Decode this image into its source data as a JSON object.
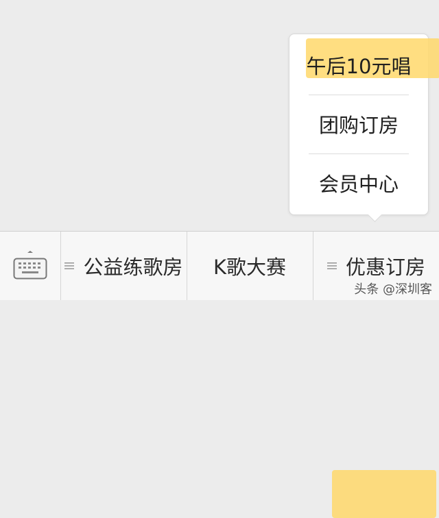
{
  "popup": {
    "items": [
      {
        "label": "午后10元唱"
      },
      {
        "label": "团购订房"
      },
      {
        "label": "会员中心"
      }
    ]
  },
  "menubar": {
    "keyboard_icon": "keyboard-icon",
    "tabs": [
      {
        "label": "公益练歌房",
        "icon": "menu-lines-icon"
      },
      {
        "label": "K歌大赛"
      },
      {
        "label": "优惠订房",
        "icon": "menu-lines-icon"
      }
    ]
  },
  "watermark": {
    "text": "头条 @深圳客"
  },
  "colors": {
    "highlight": "#ffd86b",
    "background": "#ececec",
    "menubar": "#f7f7f7"
  }
}
